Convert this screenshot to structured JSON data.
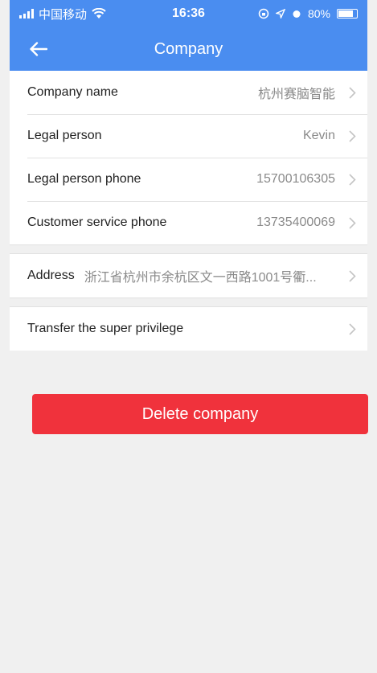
{
  "status": {
    "carrier": "中国移动",
    "time": "16:36",
    "battery": "80%",
    "battery_level": 0.8
  },
  "nav": {
    "title": "Company"
  },
  "rows": [
    {
      "label": "Company name",
      "value": "杭州赛脑智能"
    },
    {
      "label": "Legal person",
      "value": "Kevin"
    },
    {
      "label": "Legal person phone",
      "value": "15700106305"
    },
    {
      "label": "Customer service phone",
      "value": "13735400069"
    }
  ],
  "address": {
    "label": "Address",
    "value": "浙江省杭州市余杭区文一西路1001号衢..."
  },
  "transfer": {
    "label": "Transfer the super privilege"
  },
  "delete_button": {
    "label": "Delete company"
  },
  "colors": {
    "header": "#4a8df0",
    "danger": "#f0323c",
    "background": "#f0f0f0"
  }
}
